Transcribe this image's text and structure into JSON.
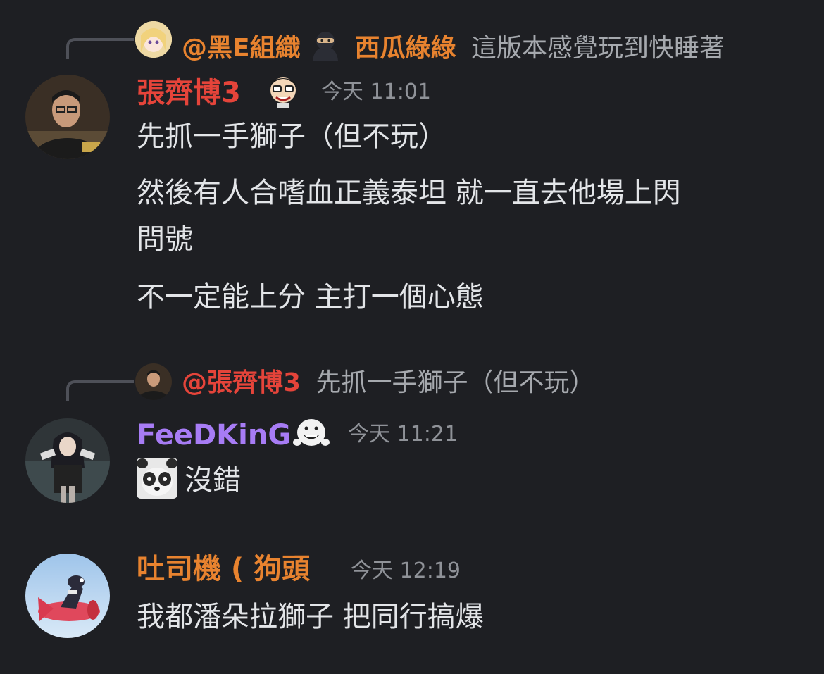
{
  "messages": [
    {
      "reply": {
        "mention": "@黑E組織",
        "nickname": "西瓜綠綠",
        "text": "這版本感覺玩到快睡著"
      },
      "author": "張齊博3",
      "author_color": "#e5443a",
      "time": "今天 11:01",
      "lines": [
        "先抓一手獅子（但不玩）",
        "然後有人合嗜血正義泰坦 就一直去他場上閃",
        "問號",
        "不一定能上分 主打一個心態"
      ]
    },
    {
      "reply": {
        "mention": "@張齊博3",
        "text": "先抓一手獅子（但不玩）"
      },
      "author": "FeeDKinG",
      "author_color": "#a77cf5",
      "time": "今天 11:21",
      "lines": [
        "沒錯"
      ]
    },
    {
      "author": "吐司機 ( 狗頭",
      "author_color": "#e8832f",
      "time": "今天 12:19",
      "lines": [
        "我都潘朵拉獅子 把同行搞爆"
      ]
    }
  ],
  "colors": {
    "background": "#1e1f23",
    "mention": "#e8832f",
    "reply_text": "#a6a9ae",
    "timestamp": "#8f9298"
  }
}
